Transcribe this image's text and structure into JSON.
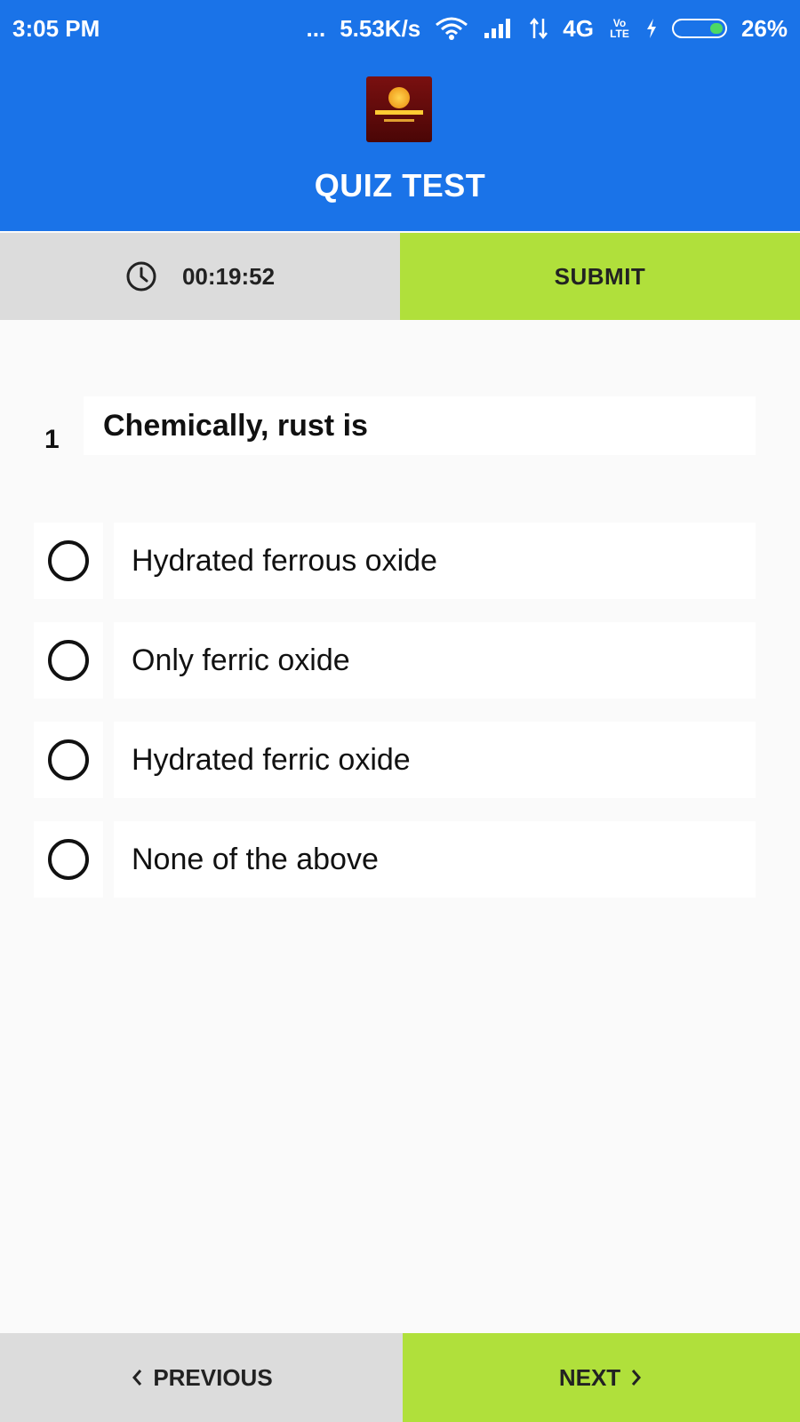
{
  "status_bar": {
    "time": "3:05 PM",
    "dots": "...",
    "speed": "5.53K/s",
    "network": "4G",
    "volte": "Vo LTE",
    "battery": "26%",
    "battery_level": 0.26
  },
  "header": {
    "title": "QUIZ TEST"
  },
  "timer": {
    "value": "00:19:52"
  },
  "actions": {
    "submit_label": "SUBMIT",
    "previous_label": "PREVIOUS",
    "next_label": "NEXT"
  },
  "question": {
    "number": "1",
    "text": "Chemically, rust is",
    "options": [
      {
        "label": "Hydrated ferrous oxide"
      },
      {
        "label": "Only ferric oxide"
      },
      {
        "label": "Hydrated ferric oxide"
      },
      {
        "label": "None of the above"
      }
    ]
  },
  "colors": {
    "header_bg": "#1a73e8",
    "accent_green": "#b0e03b",
    "neutral_gray": "#dcdcdc"
  }
}
